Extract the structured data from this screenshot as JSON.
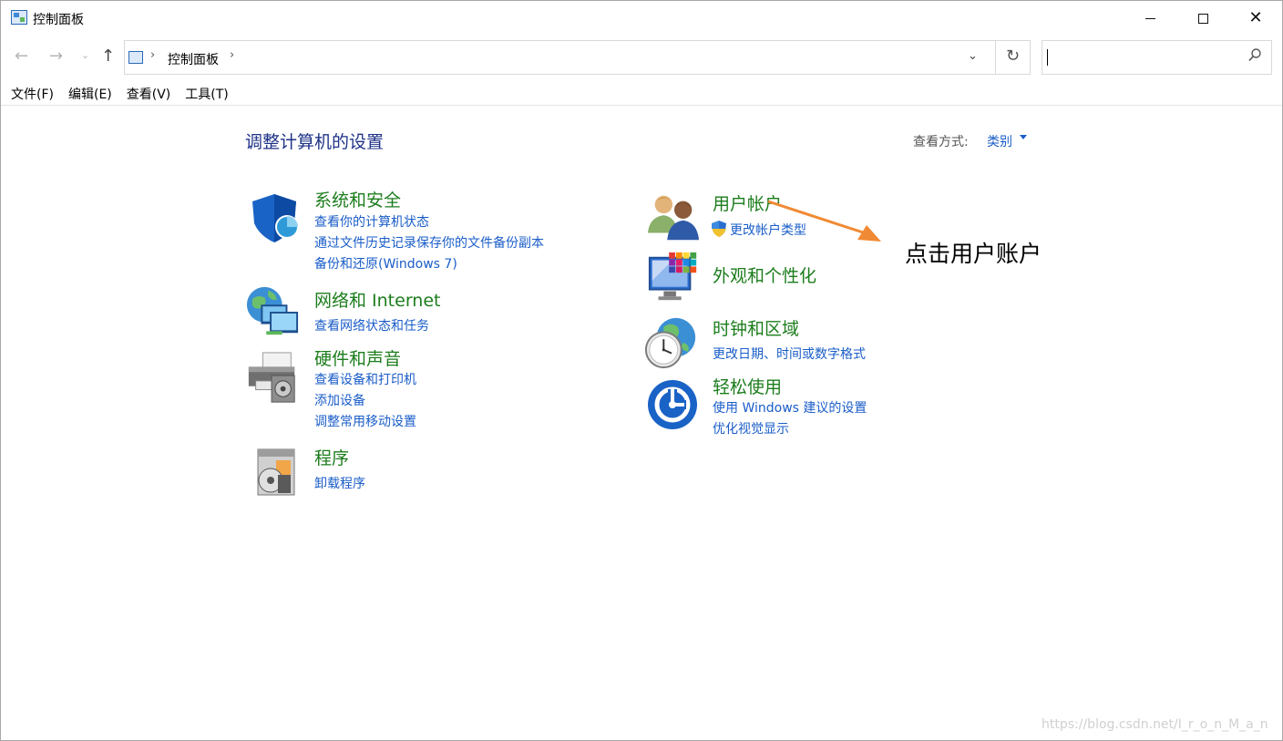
{
  "window": {
    "title": "控制面板",
    "minimize": "minimize",
    "maximize": "maximize",
    "close": "✕"
  },
  "nav": {
    "back": "←",
    "forward": "→",
    "recent": "⌄",
    "up": "↑",
    "address": "控制面板",
    "address_sep": "›",
    "dropdown": "⌄",
    "refresh": "↻",
    "search_placeholder": ""
  },
  "menu": [
    "文件(F)",
    "编辑(E)",
    "查看(V)",
    "工具(T)"
  ],
  "content": {
    "title": "调整计算机的设置",
    "view_label": "查看方式:",
    "view_value": "类别"
  },
  "categories": {
    "system": {
      "title": "系统和安全",
      "links": [
        "查看你的计算机状态",
        "通过文件历史记录保存你的文件备份副本",
        "备份和还原(Windows 7)"
      ]
    },
    "network": {
      "title": "网络和 Internet",
      "links": [
        "查看网络状态和任务"
      ]
    },
    "hardware": {
      "title": "硬件和声音",
      "links": [
        "查看设备和打印机",
        "添加设备",
        "调整常用移动设置"
      ]
    },
    "programs": {
      "title": "程序",
      "links": [
        "卸载程序"
      ]
    },
    "users": {
      "title": "用户帐户",
      "links": [
        "更改帐户类型"
      ]
    },
    "appearance": {
      "title": "外观和个性化",
      "links": []
    },
    "clock": {
      "title": "时钟和区域",
      "links": [
        "更改日期、时间或数字格式"
      ]
    },
    "ease": {
      "title": "轻松使用",
      "links": [
        "使用 Windows 建议的设置",
        "优化视觉显示"
      ]
    }
  },
  "annotation": {
    "text": "点击用户账户",
    "arrow_color": "#f08a34"
  },
  "watermark": "https://blog.csdn.net/I_r_o_n_M_a_n",
  "colors": {
    "category_title": "#1c7d1c",
    "link": "#1a5dc8",
    "page_title": "#1e3287"
  }
}
